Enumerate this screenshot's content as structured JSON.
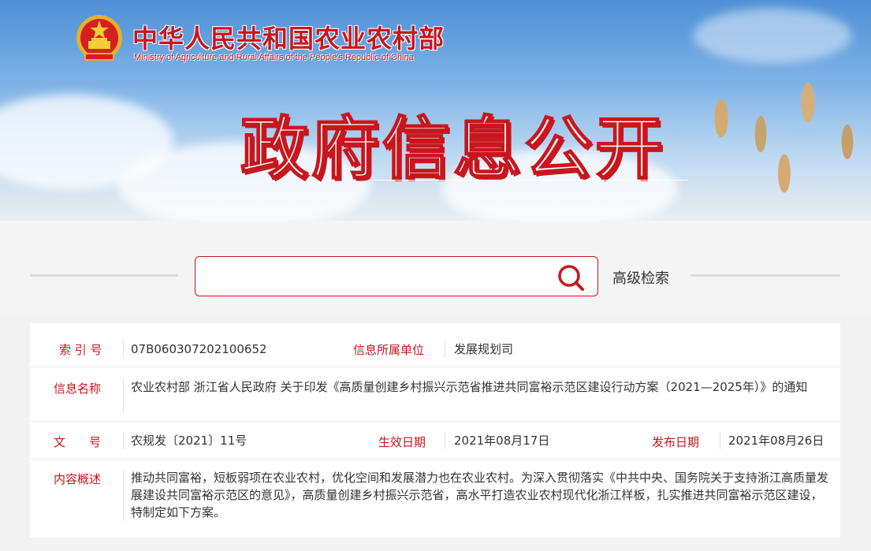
{
  "header": {
    "title": "中华人民共和国农业农村部",
    "subtitle": "Ministry of Agriculture and Rural Affairs of the People's Republic of China",
    "banner_heading": "政府信息公开"
  },
  "search": {
    "placeholder": "",
    "value": "",
    "advanced_label": "高级检索"
  },
  "info": {
    "index_label": "索 引 号",
    "index_value": "07B060307202100652",
    "unit_label": "信息所属单位",
    "unit_value": "发展规划司",
    "name_label": "信息名称",
    "name_value": "农业农村部 浙江省人民政府 关于印发《高质量创建乡村振兴示范省推进共同富裕示范区建设行动方案（2021—2025年）》的通知",
    "doc_label": "文　　号",
    "doc_value": "农规发〔2021〕11号",
    "effective_label": "生效日期",
    "effective_value": "2021年08月17日",
    "publish_label": "发布日期",
    "publish_value": "2021年08月26日",
    "summary_label": "内容概述",
    "summary_value": "推动共同富裕，短板弱项在农业农村，优化空间和发展潜力也在农业农村。为深入贯彻落实《中共中央、国务院关于支持浙江高质量发展建设共同富裕示范区的意见》，高质量创建乡村振兴示范省，高水平打造农业农村现代化浙江样板，扎实推进共同富裕示范区建设，特制定如下方案。"
  },
  "colors": {
    "accent": "#c8161d",
    "text": "#333333"
  }
}
